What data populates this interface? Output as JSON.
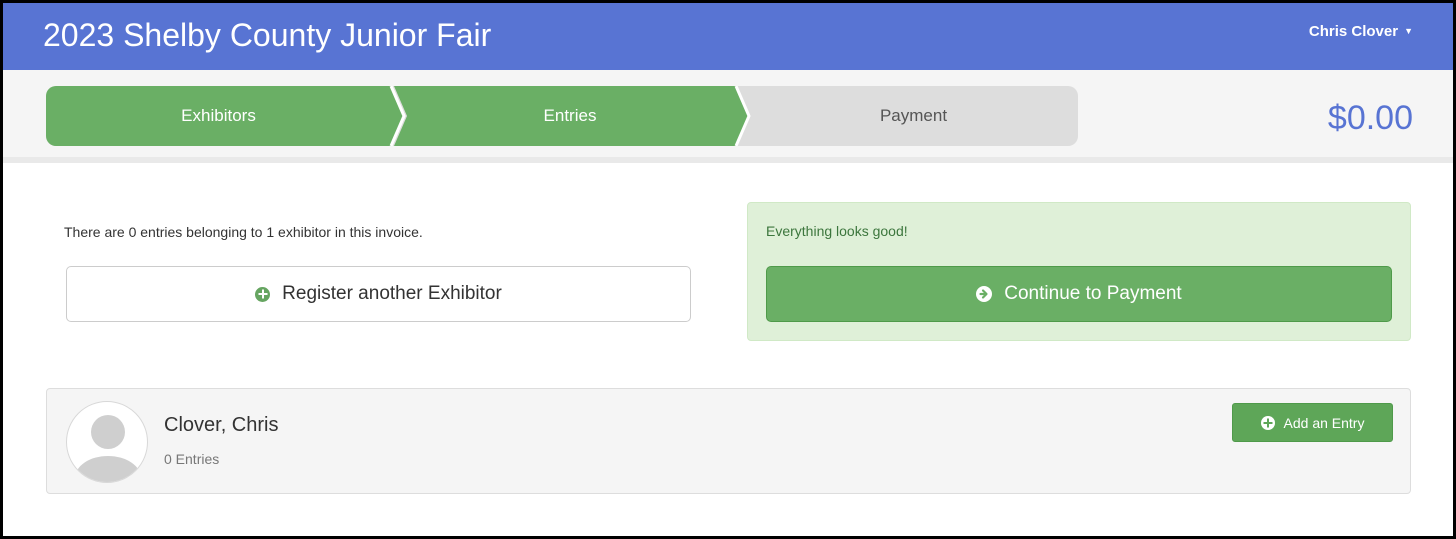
{
  "header": {
    "title": "2023 Shelby County Junior Fair",
    "user_name": "Chris Clover",
    "user_caret": "▼"
  },
  "steps": [
    {
      "label": "Exhibitors",
      "state": "done"
    },
    {
      "label": "Entries",
      "state": "done"
    },
    {
      "label": "Payment",
      "state": "todo"
    }
  ],
  "total": "$0.00",
  "summary": {
    "text": "There are 0 entries belonging to 1 exhibitor in this invoice.",
    "register_button": "Register another Exhibitor"
  },
  "status": {
    "message": "Everything looks good!",
    "continue_button": "Continue to Payment"
  },
  "exhibitor": {
    "name": "Clover, Chris",
    "entries": "0 Entries",
    "add_button": "Add an Entry"
  },
  "colors": {
    "navbar": "#5874d3",
    "step_done": "#6aaf65",
    "step_todo": "#dddddd",
    "success": "#5ea658",
    "alert_bg": "#dff0d8"
  },
  "icons": {
    "register": "plus-circle-icon",
    "continue": "arrow-circle-right-icon",
    "add": "plus-circle-icon",
    "avatar": "user-avatar-icon"
  }
}
